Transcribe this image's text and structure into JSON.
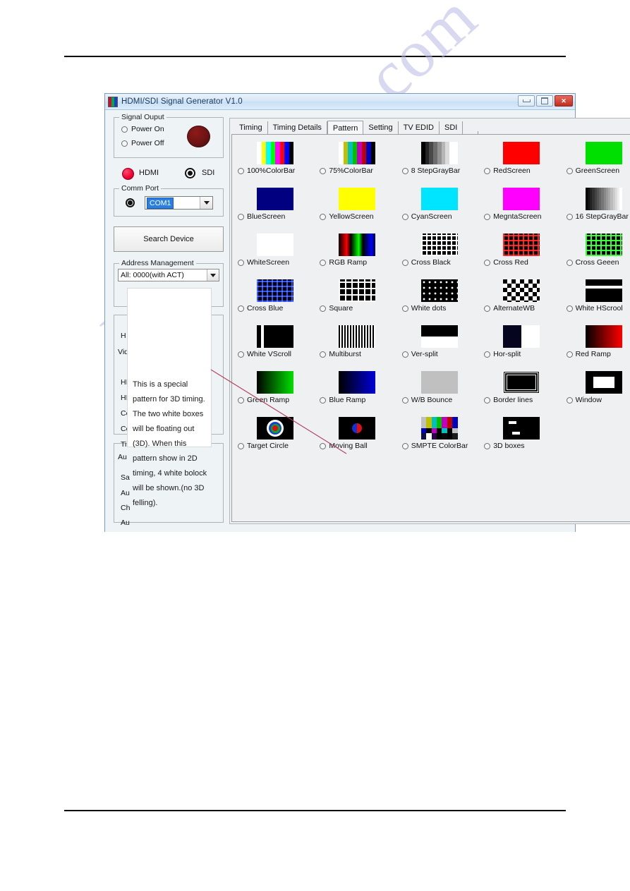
{
  "watermark": "manualshive.com",
  "window": {
    "title": "HDMI/SDI Signal Generator V1.0",
    "buttons": {
      "minimize": "minimize-button",
      "maximize": "maximize-button",
      "close": "✕"
    }
  },
  "left_panel": {
    "signal_output": {
      "title": "Signal Ouput",
      "power_on": "Power On",
      "power_off": "Power Off",
      "led_color": "#6d1414"
    },
    "interface": {
      "hdmi": "HDMI",
      "sdi": "SDI",
      "hdmi_led_color": "#f00030",
      "sdi_led_color": "#121212"
    },
    "comm_port": {
      "title": "Comm Port",
      "value": "COM1",
      "highlight_color": "#2a7fe0"
    },
    "search_device": "Search Device",
    "address_management": {
      "title": "Address Management",
      "value": "All: 0000(with ACT)"
    },
    "occluded_labels": [
      "H",
      "Vid",
      "HI",
      "HI",
      "Co",
      "Co",
      "Ti",
      "Au",
      "Sa",
      "Au",
      "Ch",
      "Au"
    ]
  },
  "tooltip": {
    "text": "This is a special pattern for 3D timing. The two white boxes will be floating out (3D). When this pattern show in 2D timing, 4 white bolock will be shown.(no 3D felling).",
    "pointer_color": "#b3405a"
  },
  "tabs": [
    {
      "label": "Timing",
      "active": false
    },
    {
      "label": "Timing Details",
      "active": false
    },
    {
      "label": "Pattern",
      "active": true
    },
    {
      "label": "Setting",
      "active": false
    },
    {
      "label": "TV EDID",
      "active": false
    },
    {
      "label": "SDI",
      "active": false
    }
  ],
  "patterns": [
    {
      "label": "100%ColorBar",
      "art": "colorbar100",
      "selected": false
    },
    {
      "label": "75%ColorBar",
      "art": "colorbar75",
      "selected": false
    },
    {
      "label": "8 StepGrayBar",
      "art": "gray8",
      "selected": false
    },
    {
      "label": "RedScreen",
      "art": "solid-red",
      "selected": false
    },
    {
      "label": "GreenScreen",
      "art": "solid-green",
      "selected": false
    },
    {
      "label": "BlueScreen",
      "art": "solid-blue",
      "selected": false
    },
    {
      "label": "YellowScreen",
      "art": "solid-yellow",
      "selected": false
    },
    {
      "label": "CyanScreen",
      "art": "solid-cyan",
      "selected": false
    },
    {
      "label": "MegntaScreen",
      "art": "solid-magenta",
      "selected": false
    },
    {
      "label": "16 StepGrayBar",
      "art": "gray16",
      "selected": false
    },
    {
      "label": "WhiteScreen",
      "art": "solid-white",
      "selected": false
    },
    {
      "label": "RGB Ramp",
      "art": "rgbramp",
      "selected": false
    },
    {
      "label": "Cross Black",
      "art": "cross-black",
      "selected": false
    },
    {
      "label": "Cross Red",
      "art": "cross-red",
      "selected": false
    },
    {
      "label": "Cross Geeen",
      "art": "cross-green",
      "selected": false
    },
    {
      "label": "Cross Blue",
      "art": "cross-blue",
      "selected": false
    },
    {
      "label": "Square",
      "art": "square",
      "selected": false
    },
    {
      "label": "White dots",
      "art": "white-dots",
      "selected": false
    },
    {
      "label": "AlternateWB",
      "art": "checker",
      "selected": false
    },
    {
      "label": "White HScrool",
      "art": "white-hscroll",
      "selected": false
    },
    {
      "label": "White VScroll",
      "art": "white-vscroll",
      "selected": false
    },
    {
      "label": "Multiburst",
      "art": "multiburst",
      "selected": false
    },
    {
      "label": "Ver-split",
      "art": "ver-split",
      "selected": false
    },
    {
      "label": "Hor-split",
      "art": "hor-split",
      "selected": false
    },
    {
      "label": "Red Ramp",
      "art": "red-ramp",
      "selected": false
    },
    {
      "label": "Green Ramp",
      "art": "green-ramp",
      "selected": false
    },
    {
      "label": "Blue Ramp",
      "art": "blue-ramp",
      "selected": false
    },
    {
      "label": "W/B Bounce",
      "art": "wb-bounce",
      "selected": false
    },
    {
      "label": "Border lines",
      "art": "border-lines",
      "selected": false
    },
    {
      "label": "Window",
      "art": "window",
      "selected": false
    },
    {
      "label": "Target Circle",
      "art": "target-circle",
      "selected": false
    },
    {
      "label": "Moving Ball",
      "art": "moving-ball",
      "selected": false
    },
    {
      "label": "SMPTE ColorBar",
      "art": "smpte",
      "selected": false
    },
    {
      "label": "3D boxes",
      "art": "3d-boxes",
      "selected": false
    }
  ]
}
